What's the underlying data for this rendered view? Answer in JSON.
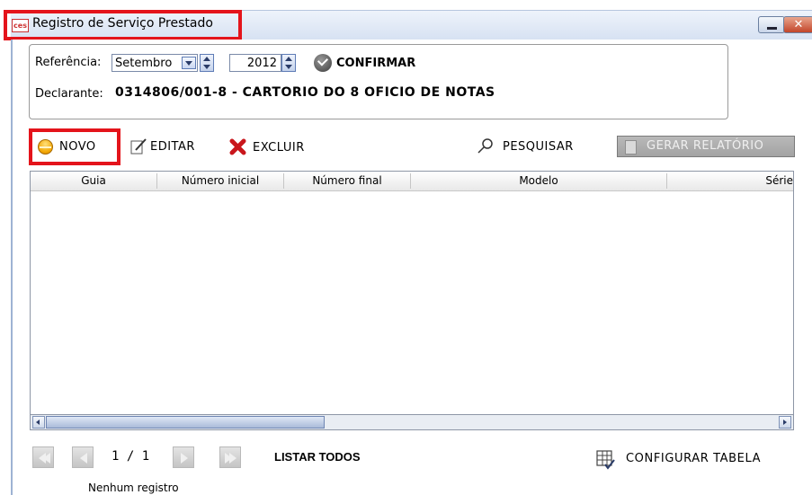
{
  "window": {
    "icon_text": "ces",
    "title": "Registro de Serviço Prestado",
    "close_label": "✕"
  },
  "reference": {
    "label": "Referência:",
    "month": "Setembro",
    "year": "2012",
    "confirm_label": "CONFIRMAR"
  },
  "declarant": {
    "label": "Declarante:",
    "value": "0314806/001-8 - CARTORIO DO 8 OFICIO DE NOTAS"
  },
  "toolbar": {
    "novo": "NOVO",
    "editar": "EDITAR",
    "excluir": "EXCLUIR",
    "pesquisar": "PESQUISAR",
    "gerar_relatorio": "GERAR RELATÓRIO"
  },
  "table": {
    "columns": [
      "Guia",
      "Número inicial",
      "Número final",
      "Modelo",
      "Série"
    ],
    "rows": []
  },
  "pagination": {
    "page_indicator": "1 / 1",
    "list_all": "LISTAR TODOS",
    "configure_table": "CONFIGURAR TABELA",
    "status": "Nenhum registro"
  },
  "colors": {
    "highlight": "#e4141b",
    "titlebar": "#d6e1f2",
    "disabled_button": "#a3a3a3"
  }
}
